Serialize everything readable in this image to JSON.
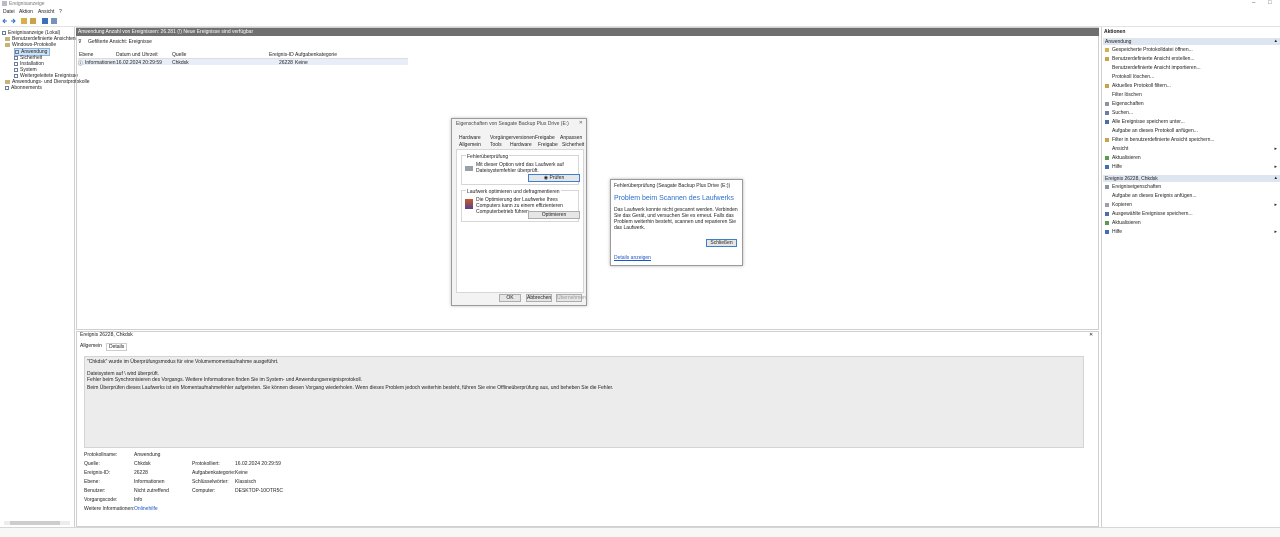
{
  "window": {
    "title": "Ereignisanzeige",
    "controls": [
      "–",
      "□"
    ]
  },
  "menu": [
    "Datei",
    "Aktion",
    "Ansicht",
    "?"
  ],
  "tree": {
    "items": [
      "Ereignisanzeige (Lokal)",
      "Benutzerdefinierte Ansichten",
      "Windows-Protokolle",
      "Anwendung",
      "Sicherheit",
      "Installation",
      "System",
      "Weitergeleitete Ereignisse",
      "Anwendungs- und Dienstprotokolle",
      "Abonnements"
    ]
  },
  "main": {
    "header": "Anwendung   Anzahl von Ereignissen: 26.281 (!) Neue Ereignisse sind verfügbar",
    "filter_label": "Gefilterte Ansicht: Ereignisse",
    "columns": [
      "Ebene",
      "Datum und Uhrzeit",
      "Quelle",
      "Ereignis-ID",
      "Aufgabenkategorie"
    ],
    "row": [
      "Informationen",
      "16.02.2024 20:29:59",
      "Chkdsk",
      "26228",
      "Keine"
    ]
  },
  "props_dialog": {
    "title": "Eigenschaften von Seagate Backup Plus Drive (E:)",
    "tabs_top": [
      "Hardware",
      "Vorgängerversionen",
      "Freigabe",
      "Anpassen"
    ],
    "tabs_bottom": [
      "Allgemein",
      "Tools",
      "Hardware",
      "Freigabe",
      "Sicherheit"
    ],
    "group1": "Fehlerüberprüfung",
    "group1_text": "Mit dieser Option wird das Laufwerk auf Dateisystemfehler überprüft.",
    "check_button": "Prüfen",
    "group2": "Laufwerk optimieren und defragmentieren",
    "group2_text": "Die Optimierung der Laufwerke Ihres Computers kann zu einem effizienteren Computerbetrieb führen.",
    "optimize_button": "Optimieren",
    "ok": "OK",
    "cancel": "Abbrechen",
    "apply": "Übernehmen"
  },
  "error_dialog": {
    "title": "Fehlerüberprüfung (Seagate Backup Plus Drive (E:))",
    "heading": "Problem beim Scannen des Laufwerks",
    "body": "Das Laufwerk konnte nicht gescannt werden. Verbinden Sie das Gerät, und versuchen Sie es erneut. Falls das Problem weiterhin besteht, scannen und reparieren Sie das Laufwerk.",
    "close_button": "Schließen",
    "details_link": "Details anzeigen"
  },
  "actions": {
    "title": "Aktionen",
    "section1": "Anwendung",
    "section1_items": [
      "Gespeicherte Protokolldatei öffnen...",
      "Benutzerdefinierte Ansicht erstellen...",
      "Benutzerdefinierte Ansicht importieren...",
      "Protokoll löschen...",
      "Aktuelles Protokoll filtern...",
      "Filter löschen",
      "Eigenschaften",
      "Suchen...",
      "Alle Ereignisse speichern unter...",
      "Aufgabe an dieses Protokoll anfügen...",
      "Filter in benutzerdefinierte Ansicht speichern...",
      "Ansicht",
      "Aktualisieren",
      "Hilfe"
    ],
    "section2": "Ereignis 26228, Chkdsk",
    "section2_items": [
      "Ereigniseigenschaften",
      "Aufgabe an dieses Ereignis anfügen...",
      "Kopieren",
      "Ausgewählte Ereignisse speichern...",
      "Aktualisieren",
      "Hilfe"
    ]
  },
  "detail": {
    "header": "Ereignis 26228, Chkdsk",
    "tabs": [
      "Allgemein",
      "Details"
    ],
    "text_lines": [
      "\"Chkdsk\" wurde im Überprüfungsmodus für eine Volumemomentaufnahme ausgeführt.",
      "Dateisystem auf \\ wird überprüft.",
      "Fehler beim Synchronisieren des Vorgangs. Weitere Informationen finden Sie im System- und Anwendungsereignisprotokoll.",
      "Beim Überprüfen dieses Laufwerks ist ein Momentaufnahmefehler aufgetreten. Sie können diesen Vorgang wiederholen. Wenn dieses Problem jedoch weiterhin besteht, führen Sie eine Offlineüberprüfung aus, und beheben Sie die Fehler."
    ],
    "fields": {
      "protokollname_label": "Protokollname:",
      "protokollname": "Anwendung",
      "quelle_label": "Quelle:",
      "quelle": "Chkdsk",
      "protokolliert_label": "Protokolliert:",
      "protokolliert": "16.02.2024 20:29:59",
      "eid_label": "Ereignis-ID:",
      "eid": "26228",
      "aufgabe_label": "Aufgabenkategorie:",
      "aufgabe": "Keine",
      "ebene_label": "Ebene:",
      "ebene": "Informationen",
      "schluessel_label": "Schlüsselwörter:",
      "schluessel": "Klassisch",
      "benutzer_label": "Benutzer:",
      "benutzer": "Nicht zutreffend",
      "computer_label": "Computer:",
      "computer": "DESKTOP-10OTR5C",
      "vorgangscode_label": "Vorgangscode:",
      "vorgangscode": "Info",
      "weitere_label": "Weitere Informationen:",
      "weitere": "Onlinehilfe"
    }
  }
}
